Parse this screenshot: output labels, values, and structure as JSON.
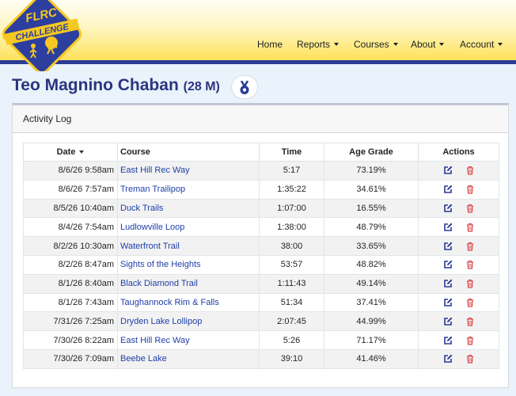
{
  "header": {
    "logo": {
      "text_top": "FLRC",
      "text_band": "CHALLENGE"
    },
    "nav": [
      {
        "label": "Home",
        "dropdown": false
      },
      {
        "label": "Reports",
        "dropdown": true
      },
      {
        "label": "Courses",
        "dropdown": true
      },
      {
        "label": "About",
        "dropdown": true
      },
      {
        "label": "Account",
        "dropdown": true
      }
    ]
  },
  "page": {
    "title": "Teo Magnino Chaban",
    "subtitle": "(28 M)",
    "badge_icon": "medal-icon"
  },
  "card": {
    "title": "Activity Log",
    "columns": [
      "Date",
      "Course",
      "Time",
      "Age Grade",
      "Actions"
    ],
    "sorted_column": "Date",
    "rows": [
      {
        "date": "8/6/26 9:58am",
        "course": "East Hill Rec Way",
        "time": "5:17",
        "age_grade": "73.19%"
      },
      {
        "date": "8/6/26 7:57am",
        "course": "Treman Trailipop",
        "time": "1:35:22",
        "age_grade": "34.61%"
      },
      {
        "date": "8/5/26 10:40am",
        "course": "Duck Trails",
        "time": "1:07:00",
        "age_grade": "16.55%"
      },
      {
        "date": "8/4/26 7:54am",
        "course": "Ludlowville Loop",
        "time": "1:38:00",
        "age_grade": "48.79%"
      },
      {
        "date": "8/2/26 10:30am",
        "course": "Waterfront Trail",
        "time": "38:00",
        "age_grade": "33.65%"
      },
      {
        "date": "8/2/26 8:47am",
        "course": "Sights of the Heights",
        "time": "53:57",
        "age_grade": "48.82%"
      },
      {
        "date": "8/1/26 8:40am",
        "course": "Black Diamond Trail",
        "time": "1:11:43",
        "age_grade": "49.14%"
      },
      {
        "date": "8/1/26 7:43am",
        "course": "Taughannock Rim & Falls",
        "time": "51:34",
        "age_grade": "37.41%"
      },
      {
        "date": "7/31/26 7:25am",
        "course": "Dryden Lake Lollipop",
        "time": "2:07:45",
        "age_grade": "44.99%"
      },
      {
        "date": "7/30/26 8:22am",
        "course": "East Hill Rec Way",
        "time": "5:26",
        "age_grade": "71.17%"
      },
      {
        "date": "7/30/26 7:09am",
        "course": "Beebe Lake",
        "time": "39:10",
        "age_grade": "41.46%"
      }
    ],
    "action_icons": [
      "edit-icon",
      "trash-icon"
    ]
  },
  "colors": {
    "nav_stripe": "#2a3a96",
    "title": "#2a3580",
    "link": "#1f3fa8",
    "edit": "#2a3a96",
    "delete": "#d94848"
  }
}
